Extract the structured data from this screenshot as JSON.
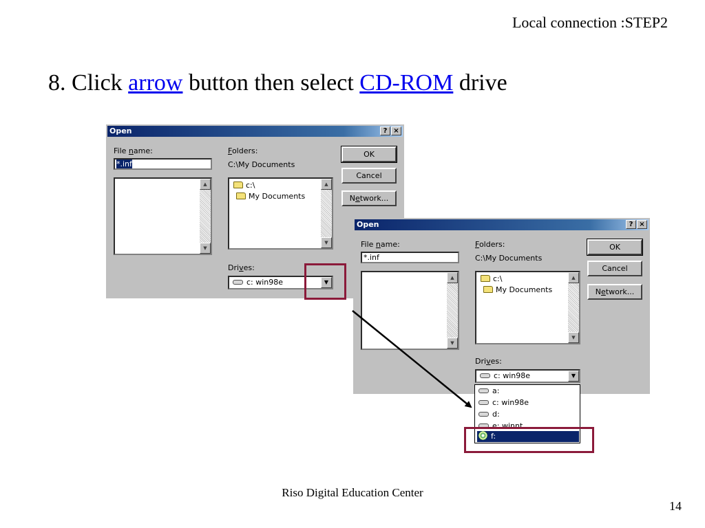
{
  "slide": {
    "header": "Local connection :STEP2",
    "instruction": {
      "prefix": "8.  Click ",
      "link1": "arrow",
      "middle": " button then select ",
      "link2": "CD-ROM",
      "suffix": " drive"
    },
    "footer": "Riso Digital Education Center",
    "page_number": "14"
  },
  "dialog": {
    "title": "Open",
    "help_label": "?",
    "close_label": "×",
    "file_name_label_pre": "File ",
    "file_name_label_u": "n",
    "file_name_label_post": "ame:",
    "file_name_value": "*.inf",
    "folders_label_u": "F",
    "folders_label_post": "olders:",
    "folders_path": "C:\\My Documents",
    "folders": [
      "c:\\",
      "My Documents"
    ],
    "drives_label_pre": "Dri",
    "drives_label_u": "v",
    "drives_label_post": "es:",
    "drive_selected": "c: win98e",
    "buttons": {
      "ok": "OK",
      "cancel": "Cancel",
      "network_u": "e",
      "network_pre": "N",
      "network_post": "twork..."
    },
    "scroll_up": "▲",
    "scroll_down": "▼",
    "combo_arrow": "▼"
  },
  "drive_dropdown": [
    "a:",
    "c: win98e",
    "d:",
    "e: winnt",
    "f:"
  ],
  "icons": {
    "folder": "folder-icon",
    "drive": "drive-icon",
    "cd": "cd-rom-icon"
  },
  "colors": {
    "highlight": "#8b1a3a",
    "link": "#0000ee",
    "titlebar": "#0a246a",
    "dialog_face": "#c0c0c0"
  }
}
